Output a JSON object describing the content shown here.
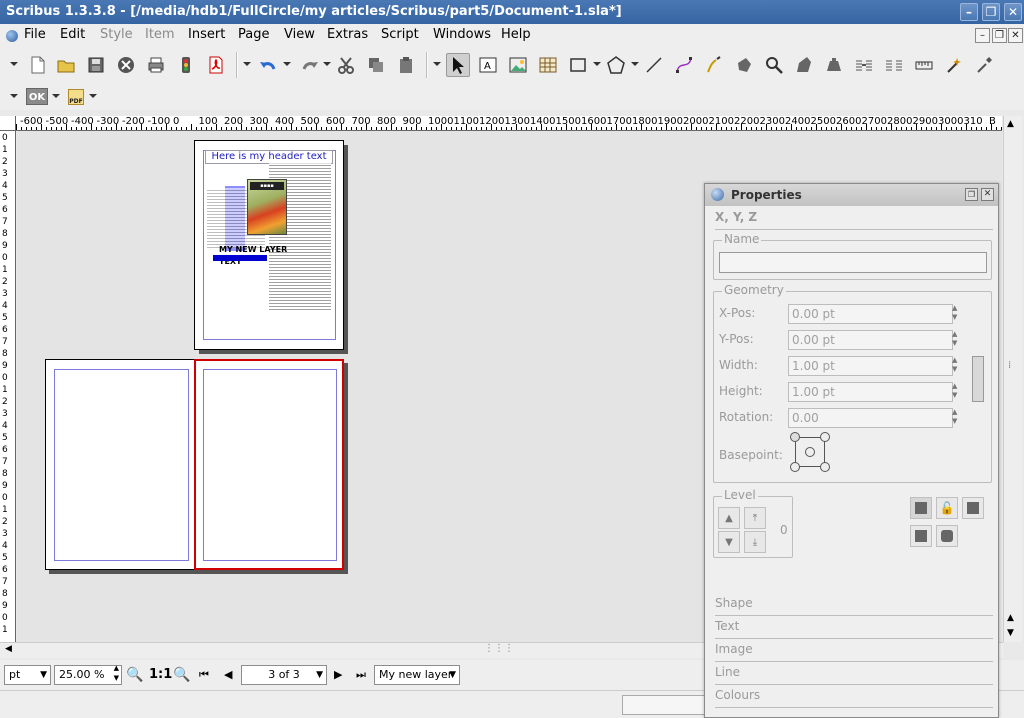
{
  "window": {
    "title": "Scribus 1.3.3.8 - [/media/hdb1/FullCircle/my articles/Scribus/part5/Document-1.sla*]",
    "buttons": [
      "–",
      "❐",
      "✕"
    ]
  },
  "menubar": {
    "items": [
      "File",
      "Edit",
      "Style",
      "Item",
      "Insert",
      "Page",
      "View",
      "Extras",
      "Script",
      "Windows",
      "Help"
    ],
    "disabled": [
      "Style",
      "Item"
    ]
  },
  "toolbar2": {
    "ok_label": "OK",
    "pdf_label": "PDF"
  },
  "ruler": {
    "h_labels": [
      "-600",
      "-500",
      "-400",
      "-300",
      "-200",
      "-100",
      "0",
      "100",
      "200",
      "300",
      "400",
      "500",
      "600",
      "700",
      "800",
      "900",
      "1000",
      "1100",
      "1200",
      "1300",
      "1400",
      "1500",
      "1600",
      "1700",
      "1800",
      "1900",
      "2000",
      "2100",
      "2200",
      "2300",
      "2400",
      "2500",
      "2600",
      "2700",
      "2800",
      "2900",
      "3000",
      "310",
      "B"
    ]
  },
  "document": {
    "header_text": "Here is my header text",
    "layer_text": "MY NEW LAYER TEXT"
  },
  "status": {
    "unit": "pt",
    "zoom": "25.00 %",
    "one_to_one": "1:1",
    "page_indicator": "3 of 3",
    "layer": "My new layer"
  },
  "properties": {
    "title": "Properties",
    "xyz_tab": "X, Y, Z",
    "name_label": "Name",
    "geometry_label": "Geometry",
    "fields": [
      {
        "label": "X-Pos:",
        "value": "0.00 pt"
      },
      {
        "label": "Y-Pos:",
        "value": "0.00 pt"
      },
      {
        "label": "Width:",
        "value": "1.00 pt"
      },
      {
        "label": "Height:",
        "value": "1.00 pt"
      },
      {
        "label": "Rotation:",
        "value": "0.00"
      }
    ],
    "basepoint_label": "Basepoint:",
    "level_label": "Level",
    "level_value": "0",
    "sections": [
      "Shape",
      "Text",
      "Image",
      "Line",
      "Colours"
    ]
  },
  "colors": {
    "titlebar": "#3a6aa8",
    "selected_page_border": "#d00000",
    "header_text": "#2020c0"
  }
}
